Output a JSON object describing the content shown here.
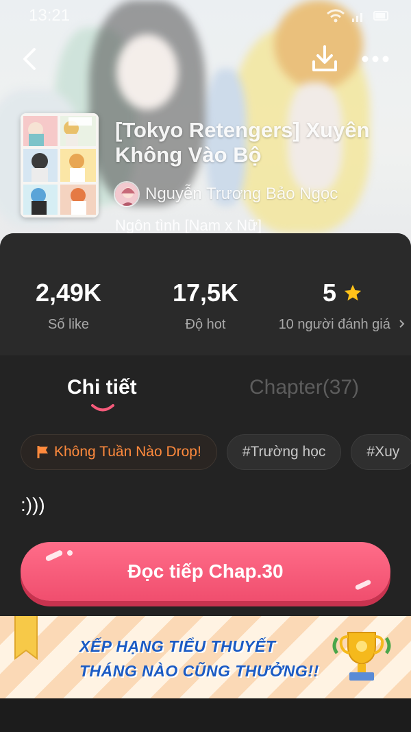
{
  "status_bar": {
    "time": "13:21",
    "icons": [
      "wifi-icon",
      "signal-icon",
      "battery-icon"
    ]
  },
  "header": {
    "title": "[Tokyo Retengers] Xuyên Không Vào Bộ",
    "author": "Nguyễn Trương Bảo Ngọc",
    "genre": "Ngôn tình [Nam x Nữ]"
  },
  "stats": {
    "likes": {
      "value": "2,49K",
      "label": "Số like"
    },
    "hot": {
      "value": "17,5K",
      "label": "Độ hot"
    },
    "rating": {
      "value": "5",
      "label": "10 người đánh giá",
      "star_color": "#ffc21a"
    }
  },
  "tabs": {
    "details": "Chi tiết",
    "chapters": "Chapter(37)"
  },
  "tags": [
    "Không Tuần Nào Drop!",
    "#Trường học",
    "#Xuy"
  ],
  "description": ":)))",
  "read_button": {
    "label": "Đọc tiếp Chap.30",
    "color": "#f55a7a"
  },
  "banner": {
    "line1": "XẾP HẠNG TIỂU THUYẾT",
    "line2": "THÁNG NÀO CŨNG THƯỞNG!!"
  },
  "colors": {
    "accent": "#f55a7a",
    "tag_orange": "#ff8a3d",
    "banner_text": "#1b5bc4"
  }
}
